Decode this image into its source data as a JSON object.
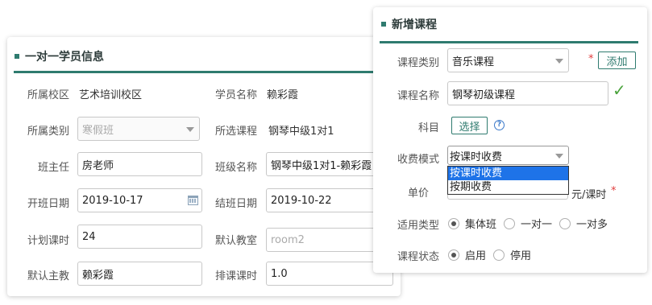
{
  "student_panel": {
    "title": "一对一学员信息",
    "fields": {
      "campus": {
        "label": "所属校区",
        "value": "艺术培训校区"
      },
      "student_name": {
        "label": "学员名称",
        "value": "赖彩霞"
      },
      "category": {
        "label": "所属类别",
        "value": "寒假班"
      },
      "selected_course": {
        "label": "所选课程",
        "value": "钢琴中级1对1"
      },
      "head_teacher": {
        "label": "班主任",
        "value": "房老师"
      },
      "class_name": {
        "label": "班级名称",
        "value": "钢琴中级1对1-赖彩霞"
      },
      "start_date": {
        "label": "开班日期",
        "value": "2019-10-17"
      },
      "end_date": {
        "label": "结班日期",
        "value": "2019-10-22"
      },
      "planned_hours": {
        "label": "计划课时",
        "value": "24"
      },
      "default_classroom": {
        "label": "默认教室",
        "placeholder": "room2"
      },
      "default_teacher": {
        "label": "默认主教",
        "value": "赖彩霞"
      },
      "scheduled_hours": {
        "label": "排课课时",
        "value": "1.0"
      }
    }
  },
  "course_panel": {
    "title": "新增课程",
    "course_category": {
      "label": "课程类别",
      "value": "音乐课程",
      "required_mark": "*",
      "add_button": "添加"
    },
    "course_name": {
      "label": "课程名称",
      "value": "钢琴初级课程"
    },
    "subject": {
      "label": "科目",
      "choose_button": "选择",
      "help": "?"
    },
    "fee_mode": {
      "label": "收费模式",
      "value": "按课时收费",
      "options": [
        "按课时收费",
        "按期收费"
      ],
      "selected_index": 0
    },
    "unit_price": {
      "label": "单价",
      "unit": "元/课时",
      "required_mark": "*"
    },
    "applicable_type": {
      "label": "适用类型",
      "options": [
        "集体班",
        "一对一",
        "一对多"
      ],
      "selected_index": 0
    },
    "course_status": {
      "label": "课程状态",
      "options": [
        "启用",
        "停用"
      ],
      "selected_index": 0
    }
  },
  "colors": {
    "accent": "#2f7b6f",
    "selection": "#1e73e8",
    "required": "#e03c3c",
    "valid": "#4aa33c"
  }
}
